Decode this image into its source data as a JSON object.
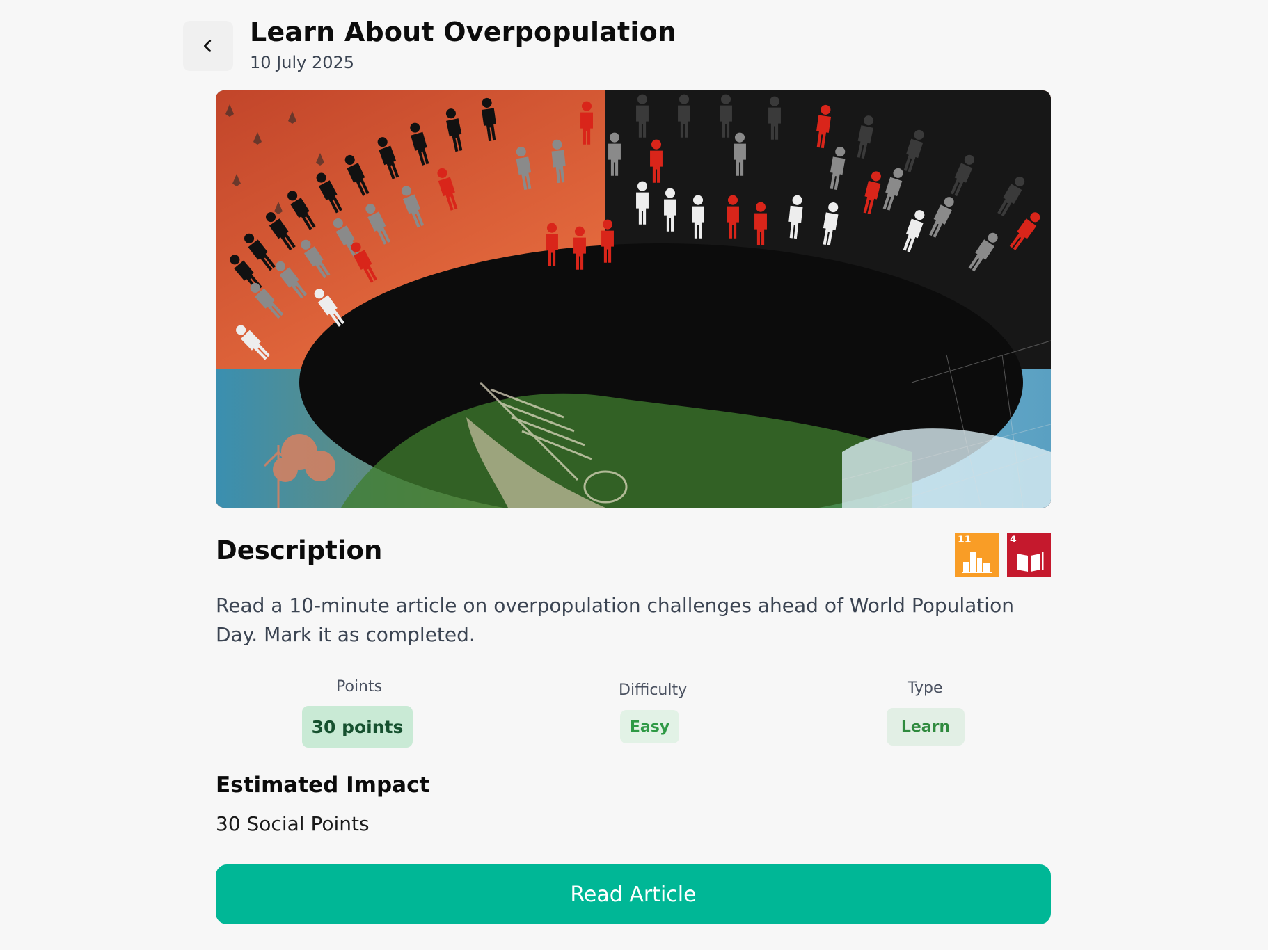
{
  "header": {
    "title": "Learn About Overpopulation",
    "date": "10 July 2025"
  },
  "hero": {
    "image_alt": "Collage of red, grey and white human figures arranged in an arc above a world map with a skeleton"
  },
  "description": {
    "heading": "Description",
    "text": "Read a 10-minute article on overpopulation challenges ahead of World Population Day. Mark it as completed.",
    "sdg_badges": [
      {
        "number": "11",
        "color": "#f99d26",
        "icon": "city-buildings-icon"
      },
      {
        "number": "4",
        "color": "#c5192d",
        "icon": "open-book-icon"
      }
    ]
  },
  "stats": {
    "points": {
      "label": "Points",
      "value": "30 points"
    },
    "difficulty": {
      "label": "Difficulty",
      "value": "Easy"
    },
    "type": {
      "label": "Type",
      "value": "Learn"
    }
  },
  "impact": {
    "heading": "Estimated Impact",
    "value": "30 Social Points"
  },
  "cta": {
    "label": "Read Article"
  },
  "colors": {
    "accent": "#00b796",
    "points_badge_bg": "#c9ead5",
    "easy_badge_bg": "#e2f2e6",
    "learn_badge_bg": "#e2efe5"
  }
}
